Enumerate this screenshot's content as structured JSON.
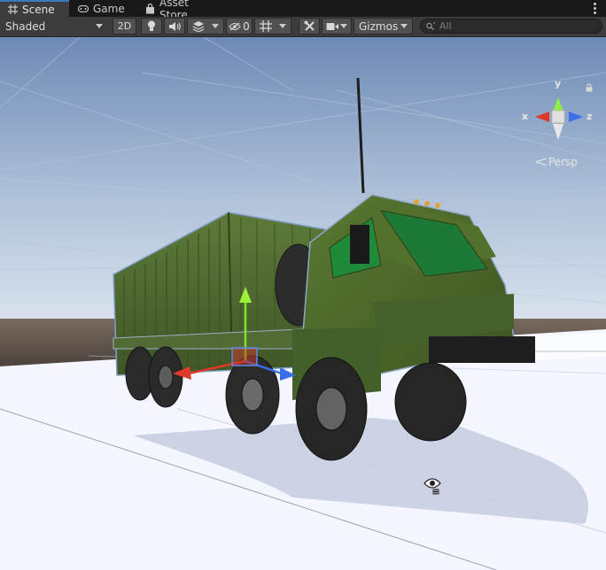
{
  "tabs": [
    {
      "label": "Scene",
      "icon": "grid-icon",
      "active": true
    },
    {
      "label": "Game",
      "icon": "gamepad-icon",
      "active": false
    },
    {
      "label": "Asset Store",
      "icon": "shopping-bag-icon",
      "active": false
    }
  ],
  "toolbar": {
    "shading_mode": "Shaded",
    "mode_2d_label": "2D",
    "hidden_count": "0",
    "gizmos_label": "Gizmos",
    "search_placeholder": "All",
    "buttons": [
      "light-bulb-icon",
      "audio-icon",
      "effects-icon",
      "visibility-icon",
      "grid-icon",
      "tools-icon",
      "camera-icon"
    ]
  },
  "scene": {
    "projection_label": "Persp",
    "gizmo_axes": {
      "x": "x",
      "y": "y",
      "z": "z"
    },
    "colors": {
      "x_axis": "#e0392b",
      "y_axis": "#7ee32c",
      "z_axis": "#3b6fe8",
      "truck_body": "#4f6a2a",
      "container": "#506a33",
      "ground": "#f4f7ff",
      "sky_top": "#6f8cb8"
    }
  }
}
